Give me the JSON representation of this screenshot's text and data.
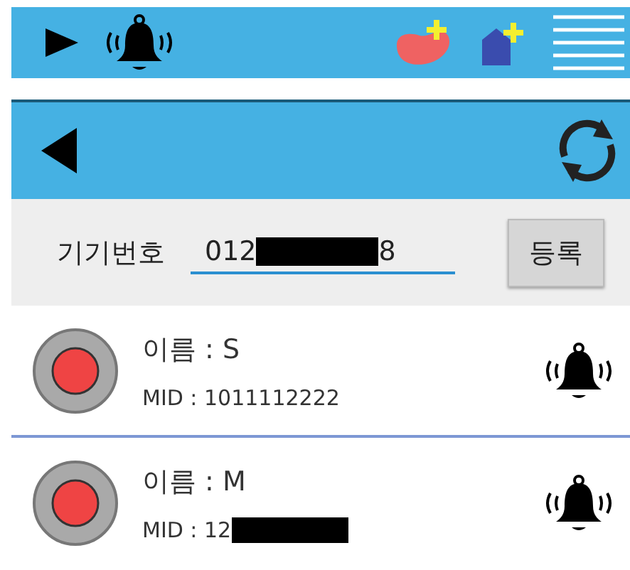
{
  "device_form": {
    "label": "기기번호",
    "value_start": "012",
    "value_end": "8",
    "register_button": "등록"
  },
  "items": [
    {
      "name": "이름 : S",
      "mid": "MID : 1011112222",
      "mid_redacted": false
    },
    {
      "name": "이름 : M",
      "mid": "MID : 12",
      "mid_redacted": true
    }
  ]
}
